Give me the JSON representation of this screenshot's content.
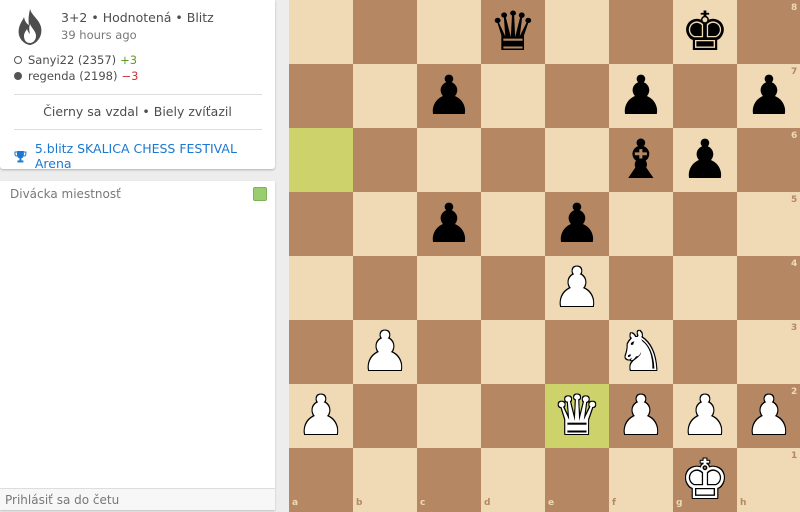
{
  "game": {
    "type": "3+2 • Hodnotená • Blitz",
    "time": "39 hours ago",
    "white": {
      "name": "Sanyi22 (2357)",
      "diff": "+3"
    },
    "black": {
      "name": "regenda (2198)",
      "diff": "−3"
    },
    "result": "Čierny sa vzdal • Biely zvíťazil",
    "tournament": "5.blitz SKALICA CHESS FESTIVAL Arena"
  },
  "chat": {
    "title": "Divácka miestnosť",
    "placeholder": "Prihlásiť sa do četu"
  },
  "board": {
    "files": [
      "a",
      "b",
      "c",
      "d",
      "e",
      "f",
      "g",
      "h"
    ],
    "ranks": [
      "8",
      "7",
      "6",
      "5",
      "4",
      "3",
      "2",
      "1"
    ],
    "highlights": [
      "a6",
      "e2"
    ],
    "pieces": [
      {
        "sq": "d8",
        "type": "queen",
        "color": "b"
      },
      {
        "sq": "g8",
        "type": "king",
        "color": "b"
      },
      {
        "sq": "c7",
        "type": "pawn",
        "color": "b"
      },
      {
        "sq": "f7",
        "type": "pawn",
        "color": "b"
      },
      {
        "sq": "h7",
        "type": "pawn",
        "color": "b"
      },
      {
        "sq": "f6",
        "type": "bishop",
        "color": "b"
      },
      {
        "sq": "g6",
        "type": "pawn",
        "color": "b"
      },
      {
        "sq": "c5",
        "type": "pawn",
        "color": "b"
      },
      {
        "sq": "e5",
        "type": "pawn",
        "color": "b"
      },
      {
        "sq": "e4",
        "type": "pawn",
        "color": "w"
      },
      {
        "sq": "b3",
        "type": "pawn",
        "color": "w"
      },
      {
        "sq": "f3",
        "type": "knight",
        "color": "w"
      },
      {
        "sq": "a2",
        "type": "pawn",
        "color": "w"
      },
      {
        "sq": "e2",
        "type": "queen",
        "color": "w"
      },
      {
        "sq": "f2",
        "type": "pawn",
        "color": "w"
      },
      {
        "sq": "g2",
        "type": "pawn",
        "color": "w"
      },
      {
        "sq": "h2",
        "type": "pawn",
        "color": "w"
      },
      {
        "sq": "g1",
        "type": "king",
        "color": "w"
      }
    ]
  }
}
